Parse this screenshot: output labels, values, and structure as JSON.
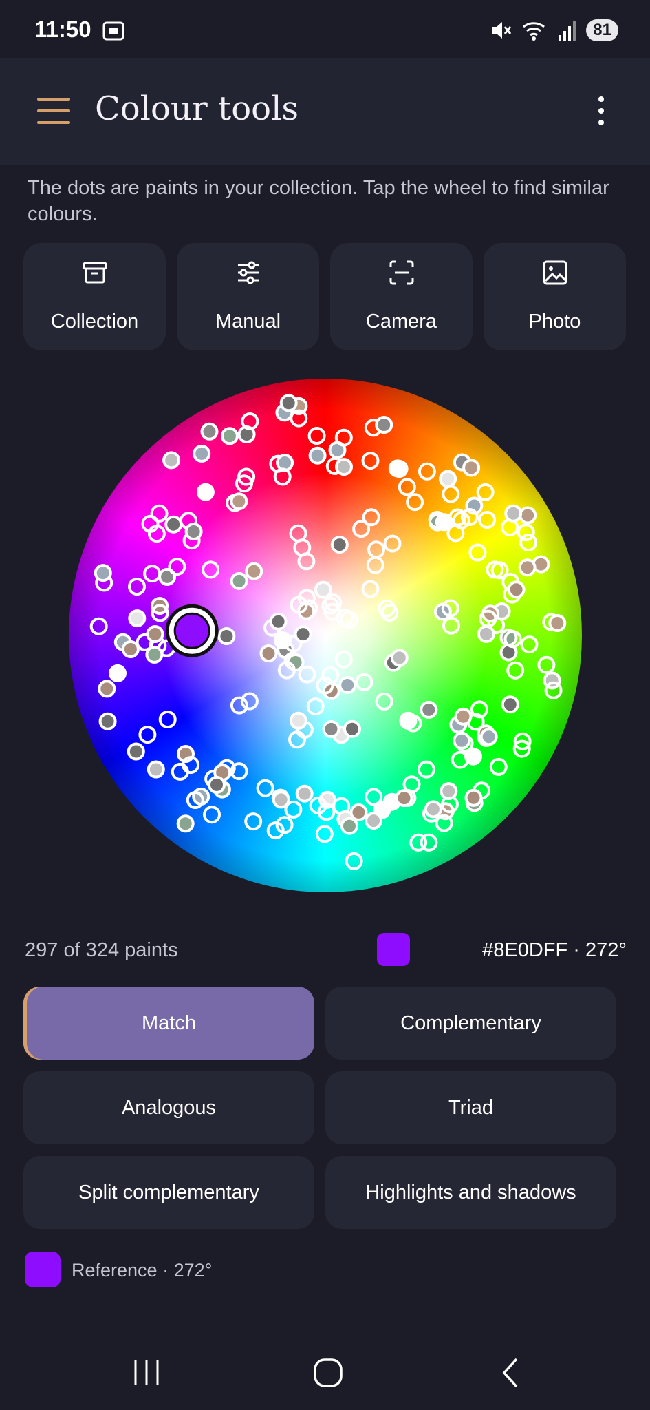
{
  "status_bar": {
    "time": "11:50",
    "battery": "81",
    "icons": [
      "screenshot-icon",
      "mute-icon",
      "wifi-icon",
      "signal-icon",
      "battery-icon"
    ]
  },
  "app_bar": {
    "title": "Colour tools",
    "menu_icon": "hamburger-menu-icon",
    "overflow_icon": "more-vert-icon"
  },
  "hint": "The dots are paints in your collection. Tap the wheel to find similar colours.",
  "tools": [
    {
      "label": "Collection",
      "icon": "archive-icon"
    },
    {
      "label": "Manual",
      "icon": "sliders-icon"
    },
    {
      "label": "Camera",
      "icon": "scan-icon"
    },
    {
      "label": "Photo",
      "icon": "image-icon"
    }
  ],
  "wheel": {
    "selected_color": "#8E0DFF",
    "selected_hue": 272
  },
  "info": {
    "paint_count": "297 of 324 paints",
    "selected_hex_label": "#8E0DFF · 272°"
  },
  "modes": [
    {
      "label": "Match",
      "active": true
    },
    {
      "label": "Complementary",
      "active": false
    },
    {
      "label": "Analogous",
      "active": false
    },
    {
      "label": "Triad",
      "active": false
    },
    {
      "label": "Split complementary",
      "active": false
    },
    {
      "label": "Highlights and shadows",
      "active": false
    }
  ],
  "reference": {
    "label": "Reference · 272°",
    "color": "#8E0DFF"
  },
  "colors": {
    "background": "#1b1c27",
    "surface": "#262735",
    "app_bar": "#232432",
    "accent": "#d7a06b",
    "active_mode": "#786aa8"
  },
  "nav": [
    "recents-icon",
    "home-icon",
    "back-icon"
  ]
}
